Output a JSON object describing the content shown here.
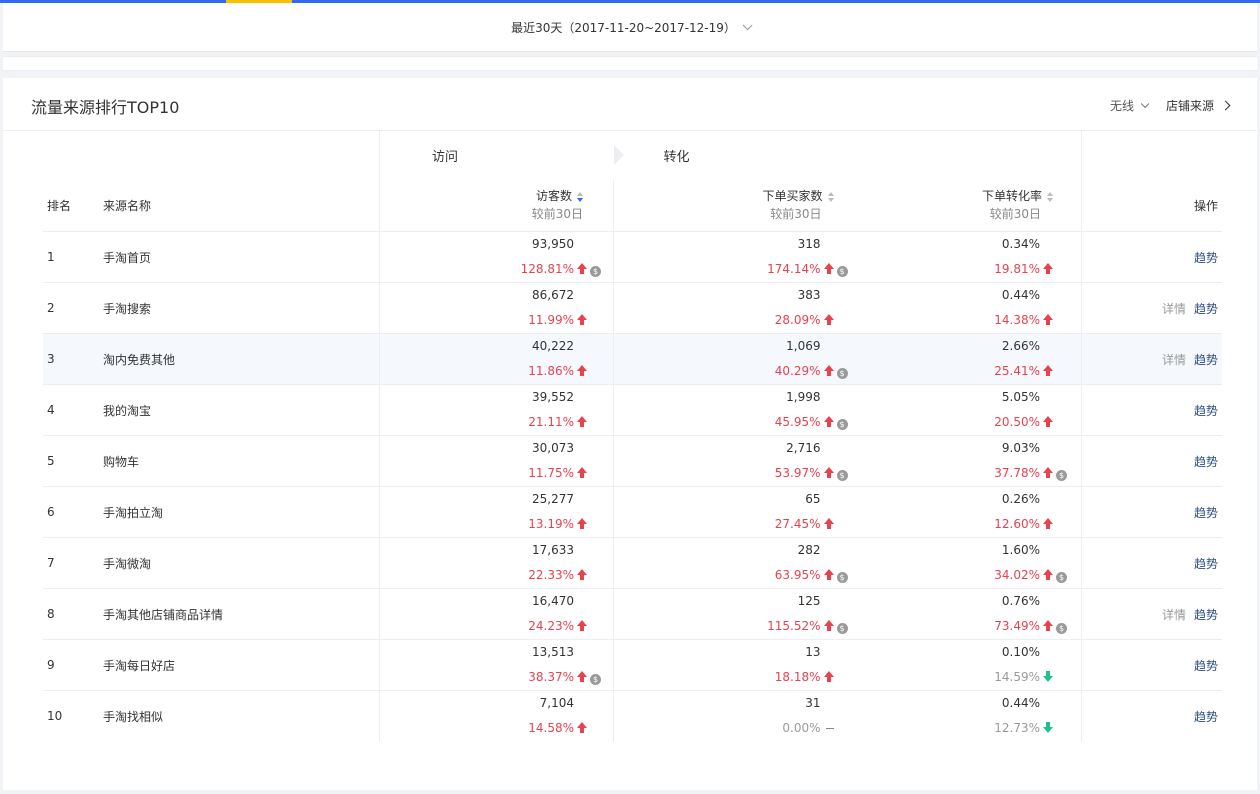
{
  "date_range": {
    "label": "最近30天（2017-11-20~2017-12-19）"
  },
  "panel": {
    "title": "流量来源排行TOP10",
    "device": "无线",
    "store_source": "店铺来源"
  },
  "table": {
    "groups": {
      "visit": "访问",
      "conversion": "转化"
    },
    "headers": {
      "rank": "排名",
      "name": "来源名称",
      "visitors": "访客数",
      "buyers": "下单买家数",
      "rate": "下单转化率",
      "compare": "较前30日",
      "ops": "操作"
    },
    "ops": {
      "detail": "详情",
      "trend": "趋势"
    },
    "rows": [
      {
        "rank": "1",
        "name": "手淘首页",
        "visitors": "93,950",
        "visitors_chg": "128.81%",
        "visitors_dir": "up",
        "visitors_info": true,
        "buyers": "318",
        "buyers_chg": "174.14%",
        "buyers_dir": "up",
        "buyers_info": true,
        "rate": "0.34%",
        "rate_chg": "19.81%",
        "rate_dir": "up",
        "rate_info": false,
        "detail": false
      },
      {
        "rank": "2",
        "name": "手淘搜索",
        "visitors": "86,672",
        "visitors_chg": "11.99%",
        "visitors_dir": "up",
        "visitors_info": false,
        "buyers": "383",
        "buyers_chg": "28.09%",
        "buyers_dir": "up",
        "buyers_info": false,
        "rate": "0.44%",
        "rate_chg": "14.38%",
        "rate_dir": "up",
        "rate_info": false,
        "detail": true
      },
      {
        "rank": "3",
        "name": "淘内免费其他",
        "visitors": "40,222",
        "visitors_chg": "11.86%",
        "visitors_dir": "up",
        "visitors_info": false,
        "buyers": "1,069",
        "buyers_chg": "40.29%",
        "buyers_dir": "up",
        "buyers_info": true,
        "rate": "2.66%",
        "rate_chg": "25.41%",
        "rate_dir": "up",
        "rate_info": false,
        "detail": true
      },
      {
        "rank": "4",
        "name": "我的淘宝",
        "visitors": "39,552",
        "visitors_chg": "21.11%",
        "visitors_dir": "up",
        "visitors_info": false,
        "buyers": "1,998",
        "buyers_chg": "45.95%",
        "buyers_dir": "up",
        "buyers_info": true,
        "rate": "5.05%",
        "rate_chg": "20.50%",
        "rate_dir": "up",
        "rate_info": false,
        "detail": false
      },
      {
        "rank": "5",
        "name": "购物车",
        "visitors": "30,073",
        "visitors_chg": "11.75%",
        "visitors_dir": "up",
        "visitors_info": false,
        "buyers": "2,716",
        "buyers_chg": "53.97%",
        "buyers_dir": "up",
        "buyers_info": true,
        "rate": "9.03%",
        "rate_chg": "37.78%",
        "rate_dir": "up",
        "rate_info": true,
        "detail": false
      },
      {
        "rank": "6",
        "name": "手淘拍立淘",
        "visitors": "25,277",
        "visitors_chg": "13.19%",
        "visitors_dir": "up",
        "visitors_info": false,
        "buyers": "65",
        "buyers_chg": "27.45%",
        "buyers_dir": "up",
        "buyers_info": false,
        "rate": "0.26%",
        "rate_chg": "12.60%",
        "rate_dir": "up",
        "rate_info": false,
        "detail": false
      },
      {
        "rank": "7",
        "name": "手淘微淘",
        "visitors": "17,633",
        "visitors_chg": "22.33%",
        "visitors_dir": "up",
        "visitors_info": false,
        "buyers": "282",
        "buyers_chg": "63.95%",
        "buyers_dir": "up",
        "buyers_info": true,
        "rate": "1.60%",
        "rate_chg": "34.02%",
        "rate_dir": "up",
        "rate_info": true,
        "detail": false
      },
      {
        "rank": "8",
        "name": "手淘其他店铺商品详情",
        "visitors": "16,470",
        "visitors_chg": "24.23%",
        "visitors_dir": "up",
        "visitors_info": false,
        "buyers": "125",
        "buyers_chg": "115.52%",
        "buyers_dir": "up",
        "buyers_info": true,
        "rate": "0.76%",
        "rate_chg": "73.49%",
        "rate_dir": "up",
        "rate_info": true,
        "detail": true
      },
      {
        "rank": "9",
        "name": "手淘每日好店",
        "visitors": "13,513",
        "visitors_chg": "38.37%",
        "visitors_dir": "up",
        "visitors_info": true,
        "buyers": "13",
        "buyers_chg": "18.18%",
        "buyers_dir": "up",
        "buyers_info": false,
        "rate": "0.10%",
        "rate_chg": "14.59%",
        "rate_dir": "down",
        "rate_info": false,
        "detail": false
      },
      {
        "rank": "10",
        "name": "手淘找相似",
        "visitors": "7,104",
        "visitors_chg": "14.58%",
        "visitors_dir": "up",
        "visitors_info": false,
        "buyers": "31",
        "buyers_chg": "0.00%",
        "buyers_dir": "flat",
        "buyers_info": false,
        "rate": "0.44%",
        "rate_chg": "12.73%",
        "rate_dir": "down",
        "rate_info": false,
        "detail": false
      }
    ]
  },
  "colors": {
    "accent_blue": "#2f6bf2",
    "tab_accent": "#f6c200",
    "up_red": "#e8424f",
    "down_green": "#1fbf8f",
    "link_blue": "#2d4e88"
  }
}
